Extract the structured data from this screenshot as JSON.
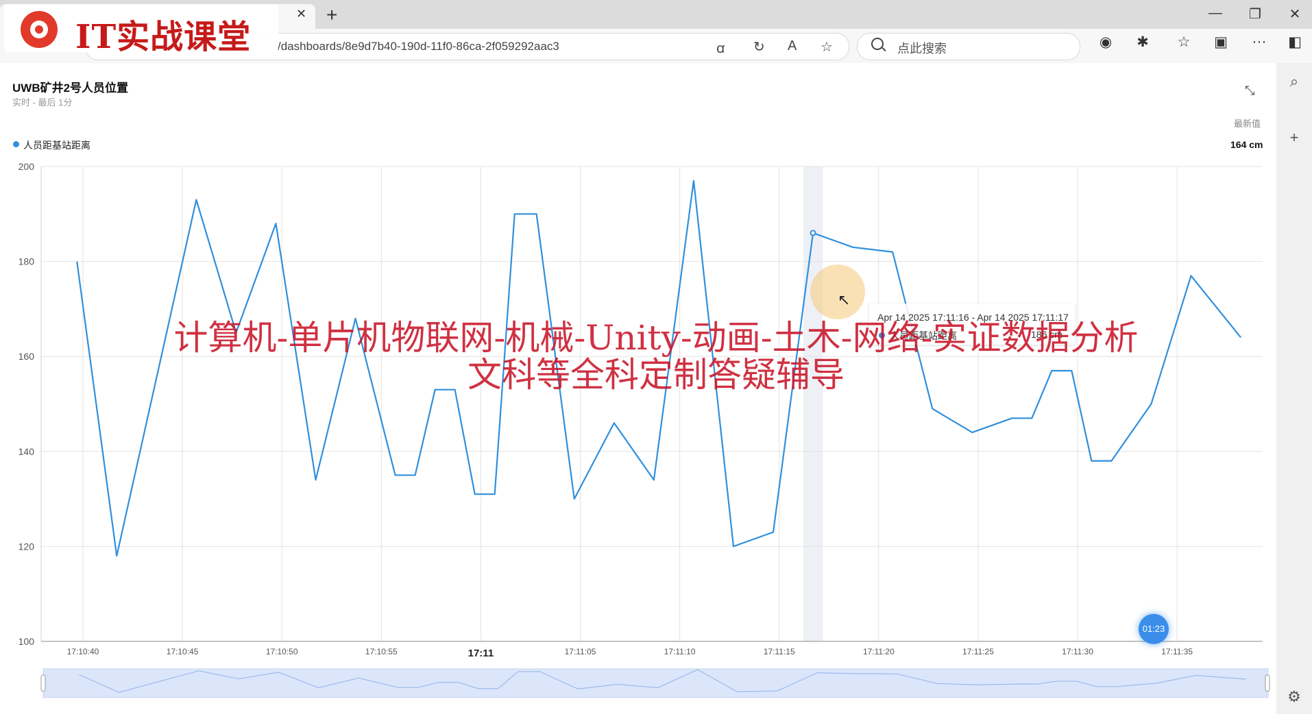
{
  "browser": {
    "brand_text": "IT实战课堂",
    "url": "/dashboards/8e9d7b40-190d-11f0-86ca-2f059292aac3",
    "search_placeholder": "点此搜索"
  },
  "panel": {
    "title": "UWB矿井2号人员位置",
    "subtitle": "实时 - 最后 1分",
    "latest_header": "最新值",
    "latest_value": "164 cm"
  },
  "tooltip": {
    "range": "Apr 14 2025 17:11:16 - Apr 14 2025 17:11:17",
    "series": "人员距基站距离",
    "value": "186 cm"
  },
  "overlay": {
    "watermark_line1": "计算机-单片机物联网-机械-Unity-动画-土木-网络-实证数据分析",
    "watermark_line2": "文科等全科定制答疑辅导",
    "timer": "01:23"
  },
  "colors": {
    "series": "#2f8fdd",
    "brand": "#c61a1a",
    "watermark": "#c81428"
  },
  "chart_data": {
    "type": "line",
    "title": "UWB矿井2号人员位置",
    "xlabel": "",
    "ylabel": "",
    "ylim": [
      100,
      200
    ],
    "yticks": [
      100,
      120,
      140,
      160,
      180,
      200
    ],
    "xticks": [
      {
        "label": "17:10:40",
        "t": 39
      },
      {
        "label": "17:10:45",
        "t": 44
      },
      {
        "label": "17:10:50",
        "t": 49
      },
      {
        "label": "17:10:55",
        "t": 54
      },
      {
        "label": "17:11",
        "t": 59,
        "bold": true
      },
      {
        "label": "17:11:05",
        "t": 64
      },
      {
        "label": "17:11:10",
        "t": 69
      },
      {
        "label": "17:11:15",
        "t": 74
      },
      {
        "label": "17:11:20",
        "t": 79
      },
      {
        "label": "17:11:25",
        "t": 84
      },
      {
        "label": "17:11:30",
        "t": 89
      },
      {
        "label": "17:11:35",
        "t": 94
      }
    ],
    "series": [
      {
        "name": "人员距基站距离",
        "points": [
          [
            38.7,
            180
          ],
          [
            40.7,
            118
          ],
          [
            44.7,
            193
          ],
          [
            46.7,
            165
          ],
          [
            48.7,
            188
          ],
          [
            50.7,
            134
          ],
          [
            52.7,
            168
          ],
          [
            54.7,
            135
          ],
          [
            55.7,
            135
          ],
          [
            56.7,
            153
          ],
          [
            57.7,
            153
          ],
          [
            58.7,
            131
          ],
          [
            59.7,
            131
          ],
          [
            60.7,
            190
          ],
          [
            61.8,
            190
          ],
          [
            63.7,
            130
          ],
          [
            65.7,
            146
          ],
          [
            67.7,
            134
          ],
          [
            69.7,
            197
          ],
          [
            71.7,
            120
          ],
          [
            73.7,
            123
          ],
          [
            75.7,
            186
          ],
          [
            77.7,
            183
          ],
          [
            79.7,
            182
          ],
          [
            81.7,
            149
          ],
          [
            83.7,
            144
          ],
          [
            85.7,
            147
          ],
          [
            86.7,
            147
          ],
          [
            87.7,
            157
          ],
          [
            88.7,
            157
          ],
          [
            89.7,
            138
          ],
          [
            90.7,
            138
          ],
          [
            92.7,
            150
          ],
          [
            94.7,
            177
          ],
          [
            97.2,
            164
          ]
        ]
      }
    ],
    "highlight_point": [
      75.7,
      186
    ]
  }
}
